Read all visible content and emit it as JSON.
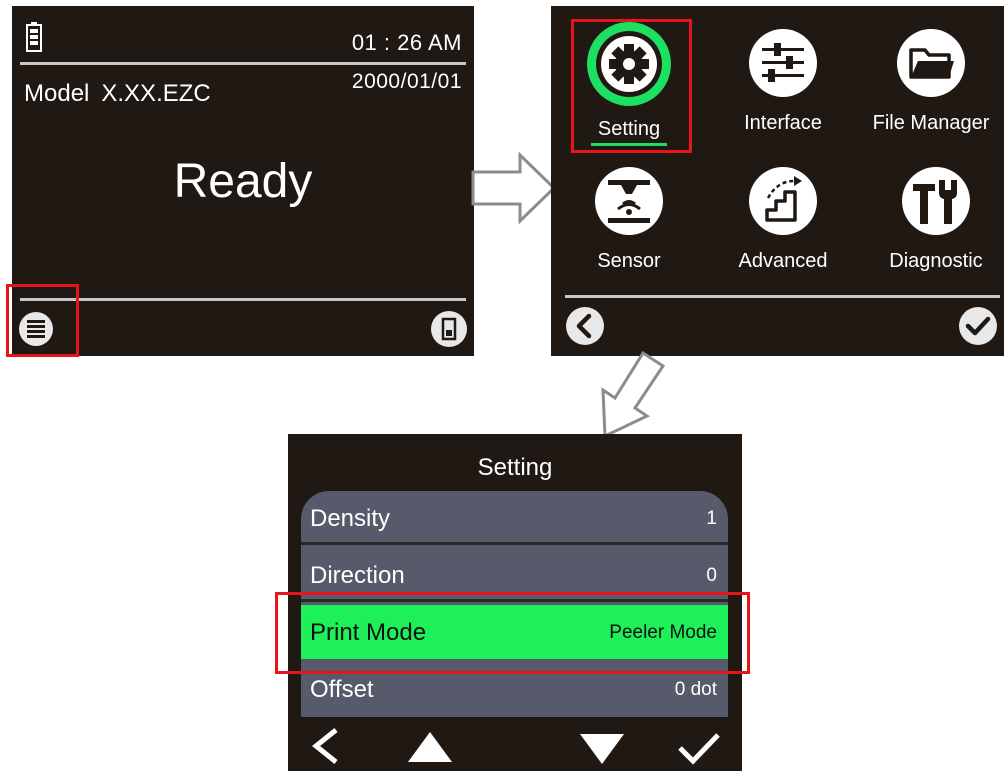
{
  "ready_screen": {
    "time": "01 : 26 AM",
    "model_label": "Model",
    "model_version": "X.XX.EZC",
    "date": "2000/01/01",
    "status": "Ready",
    "icons": [
      "battery-icon",
      "menu-icon",
      "media-icon"
    ]
  },
  "main_menu": {
    "items": [
      {
        "label": "Setting",
        "icon": "gear-icon"
      },
      {
        "label": "Interface",
        "icon": "sliders-icon"
      },
      {
        "label": "File Manager",
        "icon": "folder-icon"
      },
      {
        "label": "Sensor",
        "icon": "sensor-icon"
      },
      {
        "label": "Advanced",
        "icon": "stairs-icon"
      },
      {
        "label": "Diagnostic",
        "icon": "tools-icon"
      }
    ],
    "selected": "Setting",
    "accent_color": "#1ee060",
    "buttons": [
      "back-icon",
      "check-icon"
    ]
  },
  "setting_screen": {
    "title": "Setting",
    "rows": [
      {
        "name": "Density",
        "value": "1"
      },
      {
        "name": "Direction",
        "value": "0"
      },
      {
        "name": "Print Mode",
        "value": "Peeler Mode"
      },
      {
        "name": "Offset",
        "value": "0 dot"
      }
    ],
    "selected_row": "Print Mode",
    "highlight_color": "#1ef05a",
    "nav": [
      "back-icon",
      "up-icon",
      "down-icon",
      "check-icon"
    ]
  },
  "highlight_box_color": "#e8141b"
}
